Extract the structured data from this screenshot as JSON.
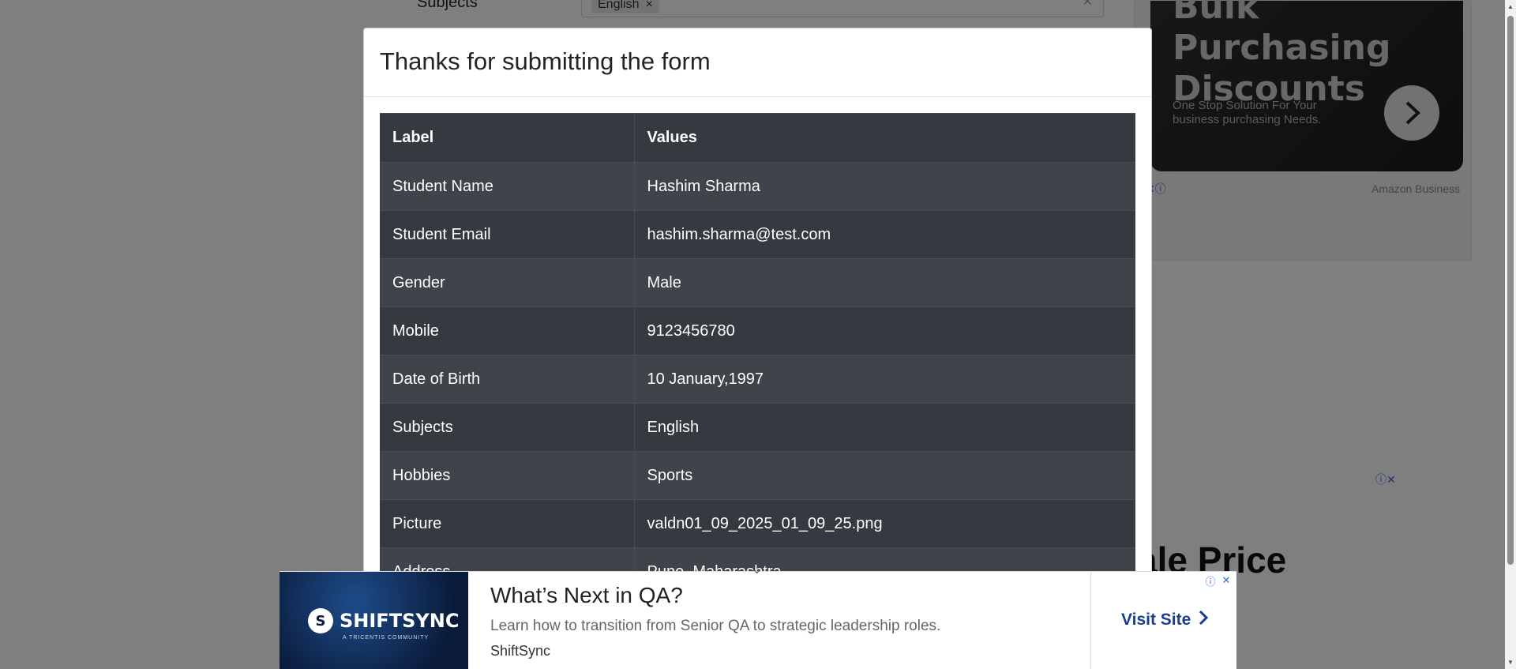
{
  "background": {
    "field_label": "Subjects",
    "selected_chip": "English",
    "chip_remove": "×",
    "clear_icon": "×",
    "ad": {
      "headline_line1": "Bulk Purchasing",
      "headline_line2": "Discounts",
      "subtext": "One Stop Solution For Your business purchasing Needs.",
      "arrow_icon": "chevron-right-icon",
      "badge": "✕ⓘ",
      "brand": "Amazon Business"
    },
    "second_ad_badge": "ⓘ✕",
    "partial_heading": "ale Price"
  },
  "modal": {
    "title": "Thanks for submitting the form",
    "table": {
      "headers": [
        "Label",
        "Values"
      ],
      "rows": [
        {
          "label": "Student Name",
          "value": "Hashim Sharma"
        },
        {
          "label": "Student Email",
          "value": "hashim.sharma@test.com"
        },
        {
          "label": "Gender",
          "value": "Male"
        },
        {
          "label": "Mobile",
          "value": "9123456780"
        },
        {
          "label": "Date of Birth",
          "value": "10 January,1997"
        },
        {
          "label": "Subjects",
          "value": "English"
        },
        {
          "label": "Hobbies",
          "value": "Sports"
        },
        {
          "label": "Picture",
          "value": "valdn01_09_2025_01_09_25.png"
        },
        {
          "label": "Address",
          "value": "Pune, Maharashtra"
        }
      ]
    }
  },
  "bottom_ad": {
    "logo_text": "SHIFTSYNC",
    "logo_mark": "S",
    "logo_sub": "A TRICENTIS COMMUNITY",
    "title": "What’s Next in QA?",
    "description": "Learn how to transition from Senior QA to strategic leadership roles.",
    "brand": "ShiftSync",
    "cta": "Visit Site",
    "cta_icon": "›",
    "info_icon": "ⓘ",
    "close_icon": "✕",
    "collapse_icon": "⌄"
  },
  "colors": {
    "table_dark": "#343a40",
    "table_stripe": "#3e444a",
    "cta_blue": "#1a3d8f",
    "ad_info_blue": "#2e6ad9"
  }
}
